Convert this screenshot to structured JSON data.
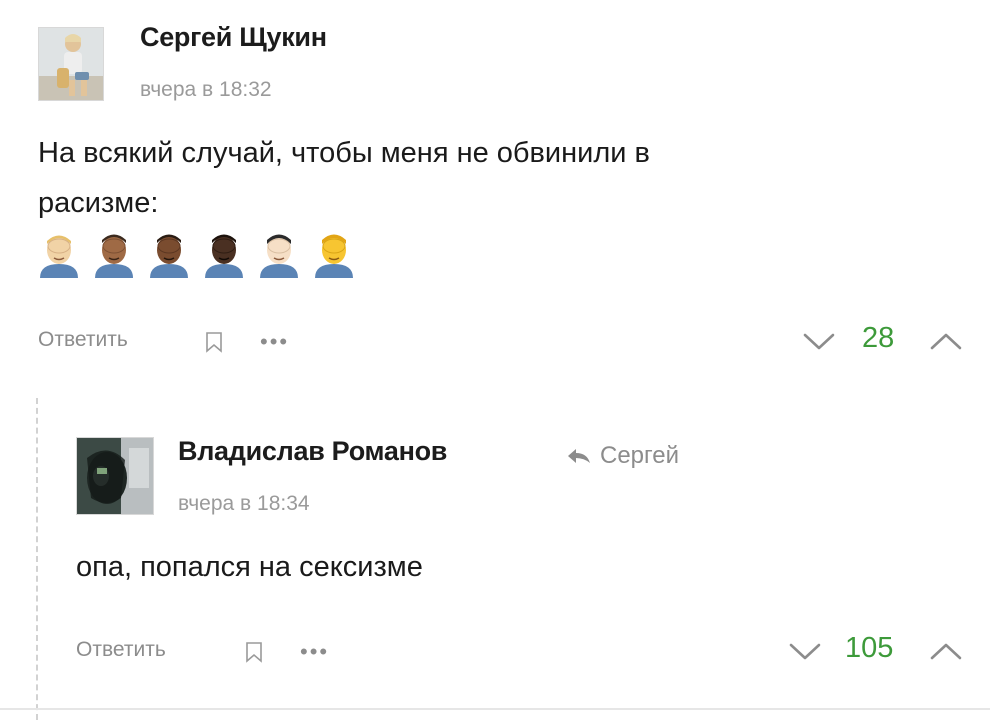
{
  "comment1": {
    "author": "Сергей Щукин",
    "time": "вчера в 18:32",
    "text_line1": "На всякий случай, чтобы меня не обвинили в",
    "text_line2": "расизме:",
    "emojis": [
      "facepalm-light",
      "facepalm-medium",
      "facepalm-medium-dark",
      "facepalm-dark",
      "facepalm-asian",
      "facepalm-yellow"
    ],
    "reply_label": "Ответить",
    "more_label": "•••",
    "score": "28"
  },
  "comment2": {
    "author": "Владислав Романов",
    "reply_to": "Сергей",
    "time": "вчера в 18:34",
    "text": "опа, попался на сексизме",
    "reply_label": "Ответить",
    "more_label": "•••",
    "score": "105"
  },
  "colors": {
    "score": "#3d9a3a",
    "muted": "#8c8c8c",
    "text": "#1a1a1a"
  }
}
